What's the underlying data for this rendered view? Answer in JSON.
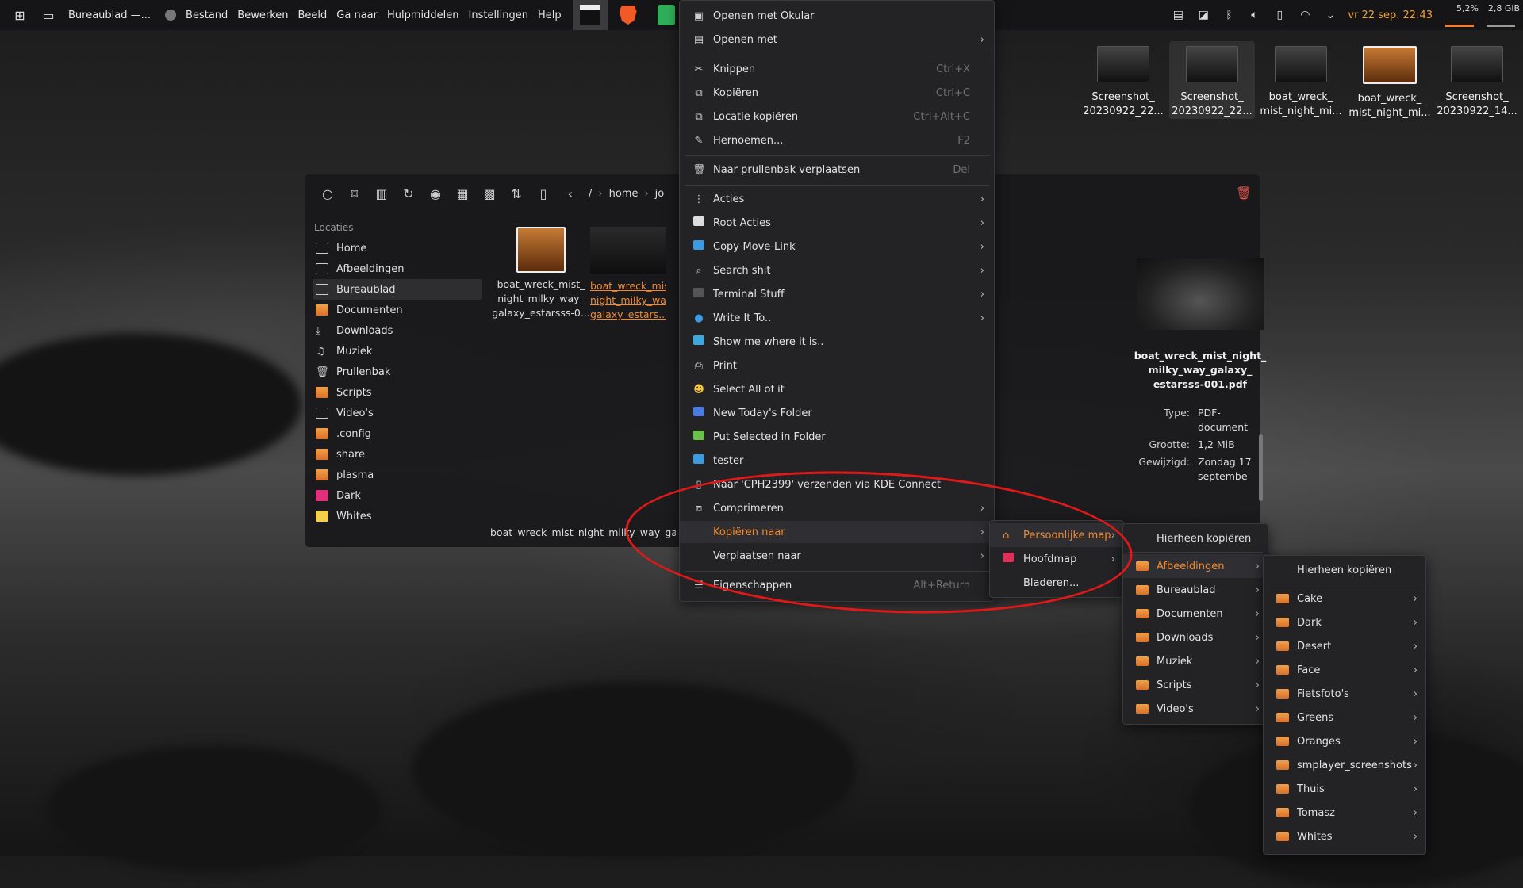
{
  "panel": {
    "title": "Bureaublad —...",
    "menus": [
      "Bestand",
      "Bewerken",
      "Beeld",
      "Ga naar",
      "Hulpmiddelen",
      "Instellingen",
      "Help"
    ],
    "clock": "vr 22 sep. 22:43",
    "cpu": "5,2%",
    "mem": "2,8 GiB"
  },
  "desktop": {
    "icons": [
      {
        "label": "Screenshot_ 20230922_22...",
        "kind": "screenshot"
      },
      {
        "label": "Screenshot_ 20230922_22...",
        "kind": "screenshot"
      },
      {
        "label": "boat_wreck_ mist_night_mi...",
        "kind": "dark"
      },
      {
        "label": "boat_wreck_ mist_night_mi...",
        "kind": "boat"
      },
      {
        "label": "Screenshot_ 20230922_14...",
        "kind": "screenshot"
      }
    ]
  },
  "dolphin": {
    "breadcrumb": [
      "/",
      "home",
      "jo"
    ],
    "places_header": "Locaties",
    "places": [
      {
        "label": "Home",
        "icon": "home-icon"
      },
      {
        "label": "Afbeeldingen",
        "icon": "image-icon"
      },
      {
        "label": "Bureaublad",
        "icon": "desktop-icon",
        "selected": true
      },
      {
        "label": "Documenten",
        "icon": "documents-folder-icon"
      },
      {
        "label": "Downloads",
        "icon": "download-icon"
      },
      {
        "label": "Muziek",
        "icon": "music-icon"
      },
      {
        "label": "Prullenbak",
        "icon": "trash-icon"
      },
      {
        "label": "Scripts",
        "icon": "folder-icon"
      },
      {
        "label": "Video's",
        "icon": "video-icon"
      },
      {
        "label": ".config",
        "icon": "folder-icon"
      },
      {
        "label": "share",
        "icon": "folder-icon"
      },
      {
        "label": "plasma",
        "icon": "folder-icon"
      },
      {
        "label": "Dark",
        "icon": "pink-folder-icon"
      },
      {
        "label": "Whites",
        "icon": "yellow-folder-icon"
      }
    ],
    "files": [
      {
        "label": "boat_wreck_mist_ night_milky_way_ galaxy_estarsss-0..."
      },
      {
        "label": "boat_wreck_mis night_milky_way galaxy_estars....p"
      }
    ],
    "status": "boat_wreck_mist_night_milky_way_gala",
    "info": {
      "filename": "boat_wreck_mist_night_ milky_way_galaxy_ estarsss-001.pdf",
      "rows": [
        {
          "key": "Type:",
          "value": "PDF- document"
        },
        {
          "key": "Grootte:",
          "value": "1,2 MiB"
        },
        {
          "key": "Gewijzigd:",
          "value": "Zondag 17 septembe"
        }
      ]
    }
  },
  "context_menu": {
    "items": [
      {
        "label": "Openen met Okular",
        "icon": "okular-icon",
        "shortcut": "",
        "sub": false
      },
      {
        "label": "Openen met",
        "icon": "open-with-icon",
        "shortcut": "",
        "sub": true
      },
      {
        "label": "Knippen",
        "icon": "cut-icon",
        "shortcut": "Ctrl+X",
        "sub": false
      },
      {
        "label": "Kopiëren",
        "icon": "copy-icon",
        "shortcut": "Ctrl+C",
        "sub": false
      },
      {
        "label": "Locatie kopiëren",
        "icon": "copy-location-icon",
        "shortcut": "Ctrl+Alt+C",
        "sub": false
      },
      {
        "label": "Hernoemen...",
        "icon": "rename-icon",
        "shortcut": "F2",
        "sub": false
      },
      {
        "label": "Naar prullenbak verplaatsen",
        "icon": "trash-icon",
        "shortcut": "Del",
        "sub": false
      },
      {
        "label": "Acties",
        "icon": "actions-icon",
        "shortcut": "",
        "sub": true
      },
      {
        "label": "Root Acties",
        "icon": "root-actions-icon",
        "shortcut": "",
        "sub": true
      },
      {
        "label": "Copy-Move-Link",
        "icon": "copy-move-link-icon",
        "shortcut": "",
        "sub": true
      },
      {
        "label": "Search shit",
        "icon": "search-icon",
        "shortcut": "",
        "sub": true
      },
      {
        "label": "Terminal Stuff",
        "icon": "terminal-icon",
        "shortcut": "",
        "sub": true
      },
      {
        "label": "Write It To..",
        "icon": "globe-icon",
        "shortcut": "",
        "sub": true
      },
      {
        "label": "Show me where it is..",
        "icon": "folder-open-icon",
        "shortcut": "",
        "sub": false
      },
      {
        "label": "Print",
        "icon": "print-icon",
        "shortcut": "",
        "sub": false
      },
      {
        "label": "Select All of it",
        "icon": "smiley-icon",
        "shortcut": "",
        "sub": false
      },
      {
        "label": "New Today's Folder",
        "icon": "calendar-icon",
        "shortcut": "",
        "sub": false
      },
      {
        "label": "Put Selected in Folder",
        "icon": "folder-add-icon",
        "shortcut": "",
        "sub": false
      },
      {
        "label": "tester",
        "icon": "tester-icon",
        "shortcut": "",
        "sub": false
      },
      {
        "label": "Naar 'CPH2399' verzenden via KDE Connect",
        "icon": "phone-icon",
        "shortcut": "",
        "sub": false
      },
      {
        "label": "Comprimeren",
        "icon": "compress-icon",
        "shortcut": "",
        "sub": true
      },
      {
        "label": "Kopiëren naar",
        "icon": "",
        "shortcut": "",
        "sub": true,
        "active": true
      },
      {
        "label": "Verplaatsen naar",
        "icon": "",
        "shortcut": "",
        "sub": true
      },
      {
        "label": "Eigenschappen",
        "icon": "properties-icon",
        "shortcut": "Alt+Return",
        "sub": false
      }
    ]
  },
  "submenu_copy_to": [
    {
      "label": "Persoonlijke map",
      "icon": "home-icon",
      "sub": true,
      "active": true
    },
    {
      "label": "Hoofdmap",
      "icon": "root-folder-icon",
      "sub": true
    },
    {
      "label": "Bladeren...",
      "icon": "",
      "sub": false
    }
  ],
  "submenu_home": [
    {
      "label": "Hierheen kopiëren",
      "icon": "",
      "sub": false
    },
    {
      "label": "Afbeeldingen",
      "icon": "folder-icon",
      "sub": true,
      "active": true
    },
    {
      "label": "Bureaublad",
      "icon": "folder-icon",
      "sub": true
    },
    {
      "label": "Documenten",
      "icon": "folder-icon",
      "sub": true
    },
    {
      "label": "Downloads",
      "icon": "folder-icon",
      "sub": true
    },
    {
      "label": "Muziek",
      "icon": "folder-icon",
      "sub": true
    },
    {
      "label": "Scripts",
      "icon": "folder-icon",
      "sub": true
    },
    {
      "label": "Video's",
      "icon": "folder-icon",
      "sub": true
    }
  ],
  "submenu_images": [
    {
      "label": "Hierheen kopiëren",
      "icon": "",
      "sub": false
    },
    {
      "label": "Cake",
      "icon": "folder-icon",
      "sub": true
    },
    {
      "label": "Dark",
      "icon": "folder-icon",
      "sub": true
    },
    {
      "label": "Desert",
      "icon": "folder-icon",
      "sub": true
    },
    {
      "label": "Face",
      "icon": "folder-icon",
      "sub": true
    },
    {
      "label": "Fietsfoto's",
      "icon": "folder-icon",
      "sub": true
    },
    {
      "label": "Greens",
      "icon": "folder-icon",
      "sub": true
    },
    {
      "label": "Oranges",
      "icon": "folder-icon",
      "sub": true
    },
    {
      "label": "smplayer_screenshots",
      "icon": "folder-icon",
      "sub": true
    },
    {
      "label": "Thuis",
      "icon": "folder-icon",
      "sub": true
    },
    {
      "label": "Tomasz",
      "icon": "folder-icon",
      "sub": true
    },
    {
      "label": "Whites",
      "icon": "folder-icon",
      "sub": true
    }
  ],
  "colors": {
    "accent": "#f08a30",
    "annotation": "#e01818",
    "menu_bg": "#232326"
  }
}
